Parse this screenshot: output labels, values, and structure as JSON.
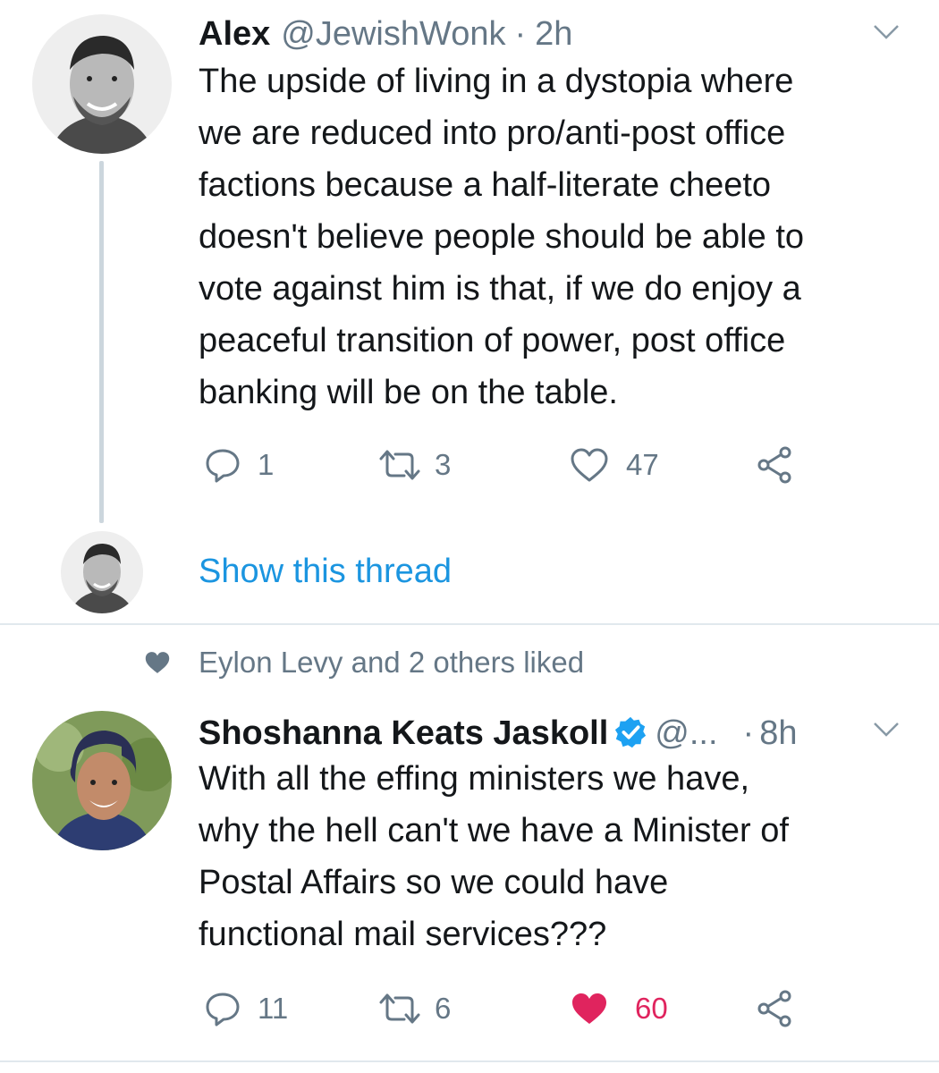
{
  "tweets": [
    {
      "name": "Alex",
      "handle": "@JewishWonk",
      "separator": "·",
      "time": "2h",
      "text_lines": [
        "The upside of living in a dystopia where",
        "we are reduced into pro/anti-post office",
        "factions because a half-literate cheeto",
        "doesn't believe people should be able to",
        "vote against him is that, if we do enjoy a",
        "peaceful transition of power, post office",
        "banking will be on the table."
      ],
      "replies": "1",
      "retweets": "3",
      "likes": "47",
      "liked": false,
      "show_thread": "Show this thread"
    },
    {
      "social_context": "Eylon Levy and 2 others liked",
      "name": "Shoshanna Keats Jaskoll",
      "verified": true,
      "handle": "@...",
      "separator": "·",
      "time": "8h",
      "text_lines": [
        "With all the effing ministers we have,",
        "why the hell can't we have a Minister of",
        "Postal Affairs so we could have",
        "functional mail services???"
      ],
      "replies": "11",
      "retweets": "6",
      "likes": "60",
      "liked": true
    }
  ],
  "colors": {
    "text": "#14171a",
    "secondary": "#657786",
    "link": "#1b95e0",
    "like": "#e0245e",
    "verified": "#1da1f2",
    "divider": "#e1e8ed"
  },
  "icons": [
    "reply-icon",
    "retweet-icon",
    "like-icon",
    "share-icon",
    "caret-down-icon",
    "verified-badge-icon",
    "heart-small-icon"
  ]
}
